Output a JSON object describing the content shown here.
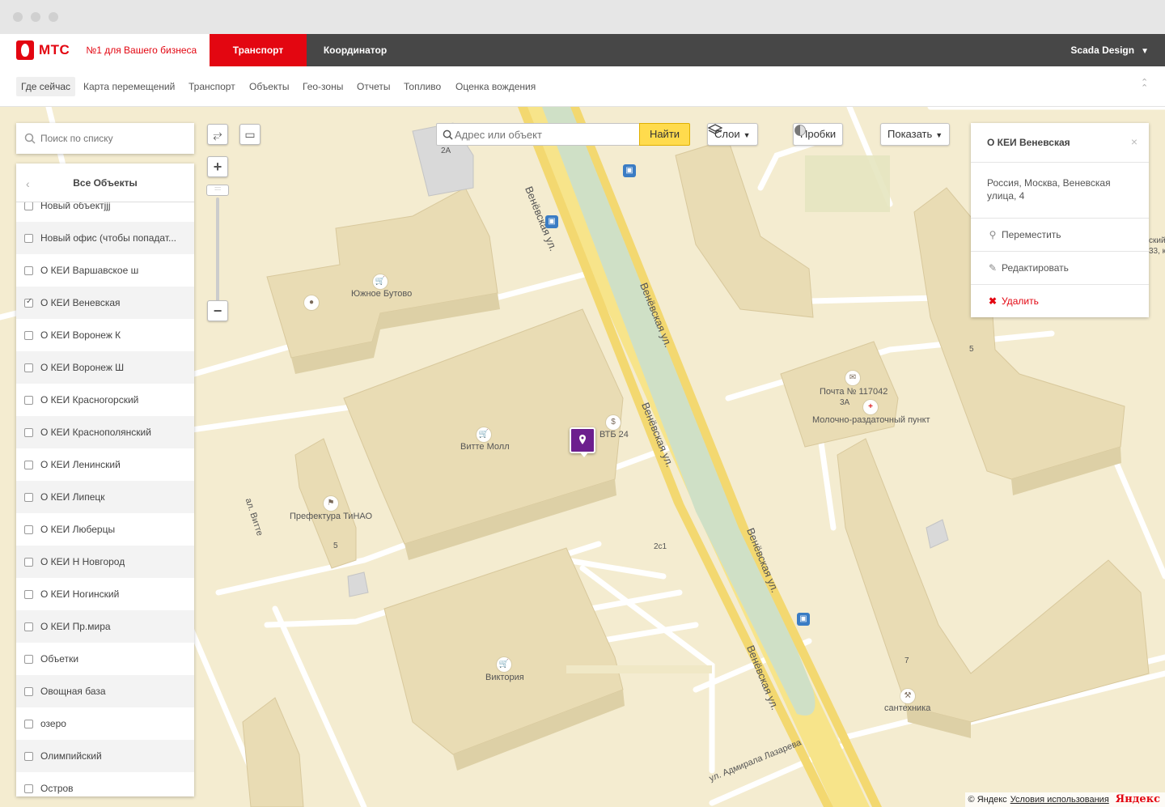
{
  "brand": {
    "name": "МТС",
    "tagline": "№1 для Вашего бизнеса"
  },
  "topnav": {
    "tabs": [
      {
        "label": "Транспорт",
        "active": true
      },
      {
        "label": "Координатор",
        "active": false
      }
    ],
    "user": "Scada Design"
  },
  "subnav": {
    "items": [
      "Где сейчас",
      "Карта перемещений",
      "Транспорт",
      "Объекты",
      "Гео-зоны",
      "Отчеты",
      "Топливо",
      "Оценка вождения"
    ],
    "active_index": 0
  },
  "sidebar": {
    "search_placeholder": "Поиск по списку",
    "list_title": "Все Объекты",
    "items": [
      {
        "label": "Новый объектjjj",
        "checked": false
      },
      {
        "label": "Новый офис (чтобы попадат...",
        "checked": false
      },
      {
        "label": "О КЕИ Варшавское ш",
        "checked": false
      },
      {
        "label": "О КЕИ Веневская",
        "checked": true
      },
      {
        "label": "О КЕИ Воронеж К",
        "checked": false
      },
      {
        "label": "О КЕИ Воронеж Ш",
        "checked": false
      },
      {
        "label": "О КЕИ Красногорский",
        "checked": false
      },
      {
        "label": "О КЕИ Краснополянский",
        "checked": false
      },
      {
        "label": "О КЕИ Ленинский",
        "checked": false
      },
      {
        "label": "О КЕИ Липецк",
        "checked": false
      },
      {
        "label": "О КЕИ Люберцы",
        "checked": false
      },
      {
        "label": "О КЕИ Н Новгород",
        "checked": false
      },
      {
        "label": "О КЕИ Ногинский",
        "checked": false
      },
      {
        "label": "О КЕИ Пр.мира",
        "checked": false
      },
      {
        "label": "Объетки",
        "checked": false
      },
      {
        "label": "Овощная база",
        "checked": false
      },
      {
        "label": "озеро",
        "checked": false
      },
      {
        "label": "Олимпийский",
        "checked": false
      },
      {
        "label": "Остров",
        "checked": false
      }
    ]
  },
  "map_toolbar": {
    "address_placeholder": "Адрес или объект",
    "find_label": "Найти",
    "layers_label": "Слои",
    "traffic_label": "Пробки",
    "show_label": "Показать"
  },
  "info_panel": {
    "title": "О КЕИ Веневская",
    "address": "Россия, Москва, Веневская улица, 4",
    "actions": {
      "move": "Переместить",
      "edit": "Редактировать",
      "delete": "Удалить"
    }
  },
  "map_labels": {
    "streets": {
      "venevskaya_1": "Венёвская ул.",
      "venevskaya_2": "Венёвская ул.",
      "venevskaya_3": "Венёвская ул.",
      "venevskaya_4": "Венёвская ул.",
      "venevskaya_5": "Венёвская ул.",
      "vitte": "ал. Витте",
      "lazarev": "ул. Адмирала Лазарева"
    },
    "places": {
      "yuzhnoe_butovo": "Южное Бутово",
      "vitte_mall": "Витте Молл",
      "vtb": "ВТБ 24",
      "prefecture": "Префектура ТиНАО",
      "viktoria": "Виктория",
      "post": "Почта № 117042",
      "milk": "Молочно-раздаточный пункт",
      "santehnika": "сантехника"
    },
    "house_numbers": {
      "h2a": "2А",
      "h3a": "3А",
      "h5a": "5",
      "h5b": "5",
      "h2c1": "2с1",
      "h7": "7"
    },
    "edge_text": {
      "line1": "ский",
      "line2": "33, к"
    }
  },
  "copyright": {
    "text": "© Яндекс",
    "terms": "Условия использования",
    "logo": "Яндекс"
  },
  "colors": {
    "accent": "#e30611",
    "topbar": "#474747",
    "marker": "#6c1f8e",
    "find_button": "#ffdb4d",
    "map_ground": "#f4ecd0"
  }
}
